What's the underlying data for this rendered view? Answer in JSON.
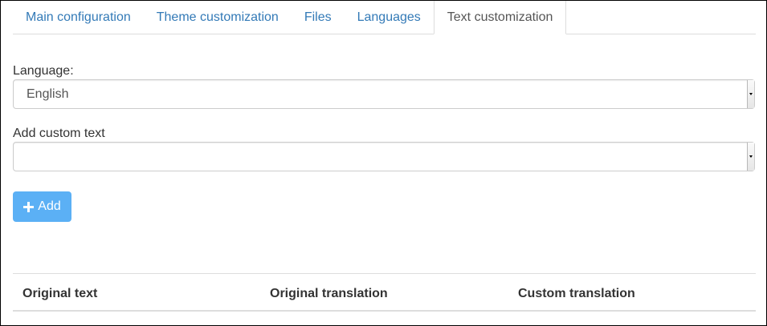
{
  "tabs": [
    {
      "label": "Main configuration",
      "active": false
    },
    {
      "label": "Theme customization",
      "active": false
    },
    {
      "label": "Files",
      "active": false
    },
    {
      "label": "Languages",
      "active": false
    },
    {
      "label": "Text customization",
      "active": true
    }
  ],
  "form": {
    "language_label": "Language:",
    "language_value": "English",
    "custom_text_label": "Add custom text",
    "custom_text_value": "",
    "add_button_label": "Add"
  },
  "table": {
    "headers": [
      "Original text",
      "Original translation",
      "Custom translation"
    ]
  },
  "colors": {
    "link": "#337ab7",
    "add_button": "#5bb0f5",
    "border": "#dddddd"
  }
}
